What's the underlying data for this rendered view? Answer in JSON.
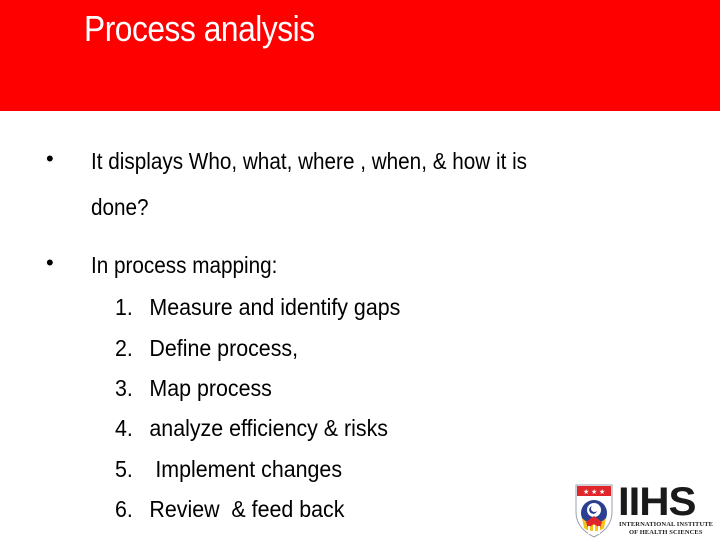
{
  "slide": {
    "title": "Process analysis",
    "accent_color": "#fe0000",
    "bullets": [
      {
        "marker": "•",
        "line1": "It displays Who, what, where , when, & how it is",
        "line2": "done?"
      },
      {
        "marker": "•",
        "line1": "In process mapping:"
      }
    ],
    "steps": [
      {
        "num": "1.",
        "text": "Measure and identify gaps"
      },
      {
        "num": "2.",
        "text": "Define process,"
      },
      {
        "num": "3.",
        "text": "Map process"
      },
      {
        "num": "4.",
        "text": "analyze efficiency & risks"
      },
      {
        "num": "5.",
        "text": " Implement changes"
      },
      {
        "num": "6.",
        "text": "Review  & feed back"
      }
    ]
  },
  "logo": {
    "letters": "IIHS",
    "line1": "INTERNATIONAL INSTITUTE",
    "line2": "OF HEALTH SCIENCES",
    "icon": "shield-crest-icon"
  }
}
